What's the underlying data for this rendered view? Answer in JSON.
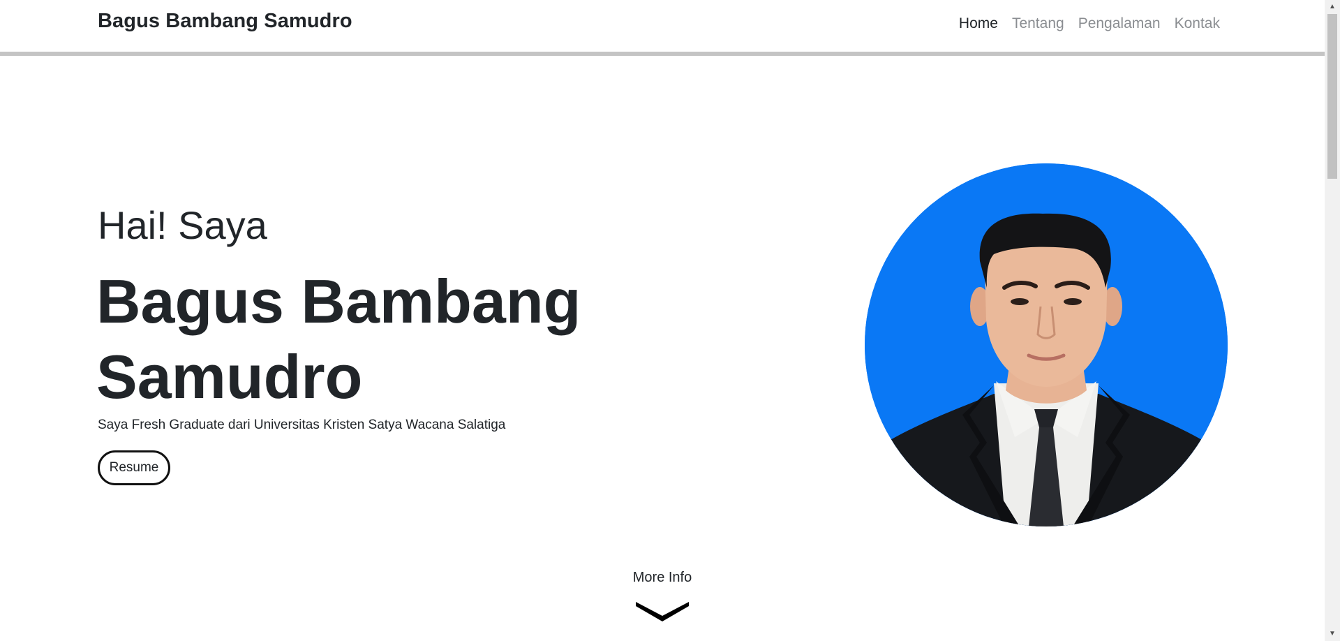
{
  "navbar": {
    "brand": "Bagus Bambang Samudro",
    "links": [
      {
        "label": "Home",
        "active": true
      },
      {
        "label": "Tentang",
        "active": false
      },
      {
        "label": "Pengalaman",
        "active": false
      },
      {
        "label": "Kontak",
        "active": false
      }
    ]
  },
  "hero": {
    "greeting": "Hai! Saya",
    "name": "Bagus Bambang Samudro",
    "subtitle": "Saya Fresh Graduate dari Universitas Kristen Satya Wacana Salatiga",
    "resume_label": "Resume"
  },
  "more_info": {
    "label": "More Info",
    "icon": "chevron-down-icon"
  },
  "colors": {
    "photo_background": "#0a78f5",
    "nav_active": "#212529",
    "nav_inactive": "#8a8d91"
  }
}
